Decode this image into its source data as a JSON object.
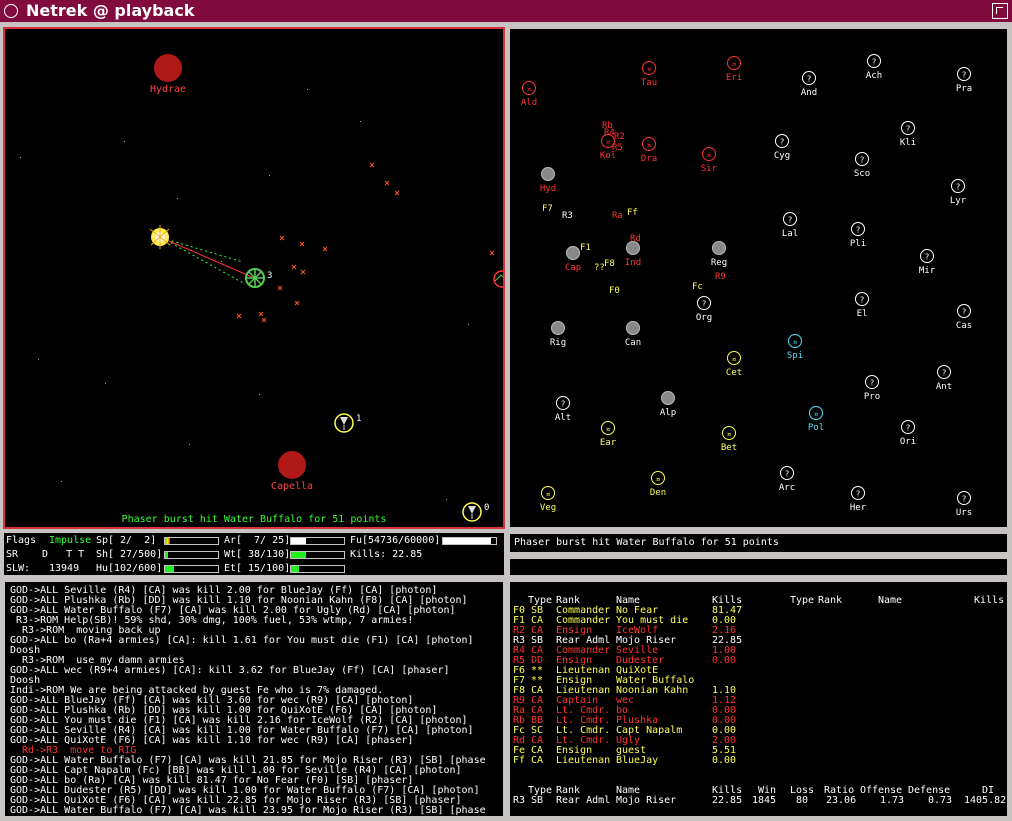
{
  "window": {
    "title": "Netrek  @  playback"
  },
  "tactical": {
    "message": "Phaser burst hit Water Buffalo for 51 points",
    "planets": [
      {
        "name": "Hydrae"
      },
      {
        "name": "Capella"
      }
    ],
    "ships": [
      {
        "id": "3"
      },
      {
        "id": "1"
      },
      {
        "id": "0"
      }
    ]
  },
  "galactic": {
    "planets": [
      {
        "name": "Ald",
        "owner": "red"
      },
      {
        "name": "Tau",
        "owner": "red"
      },
      {
        "name": "Eri",
        "owner": "red"
      },
      {
        "name": "And",
        "owner": "neutral"
      },
      {
        "name": "Ach",
        "owner": "neutral"
      },
      {
        "name": "Pra",
        "owner": "neutral"
      },
      {
        "name": "Kli",
        "owner": "neutral"
      },
      {
        "name": "Kol",
        "owner": "red"
      },
      {
        "name": "Dra",
        "owner": "red"
      },
      {
        "name": "Sir",
        "owner": "red"
      },
      {
        "name": "Cyg",
        "owner": "neutral"
      },
      {
        "name": "Sco",
        "owner": "neutral"
      },
      {
        "name": "Lyr",
        "owner": "neutral"
      },
      {
        "name": "Hyd",
        "owner": "red"
      },
      {
        "name": "Lal",
        "owner": "neutral"
      },
      {
        "name": "Pli",
        "owner": "neutral"
      },
      {
        "name": "Mir",
        "owner": "neutral"
      },
      {
        "name": "Cap",
        "owner": "red"
      },
      {
        "name": "Ind",
        "owner": "red"
      },
      {
        "name": "Reg",
        "owner": "neutral"
      },
      {
        "name": "Org",
        "owner": "neutral"
      },
      {
        "name": "El",
        "owner": "neutral"
      },
      {
        "name": "Cas",
        "owner": "neutral"
      },
      {
        "name": "Rig",
        "owner": "neutral"
      },
      {
        "name": "Can",
        "owner": "neutral"
      },
      {
        "name": "Spi",
        "owner": "cyan"
      },
      {
        "name": "Cet",
        "owner": "yellow"
      },
      {
        "name": "Ant",
        "owner": "neutral"
      },
      {
        "name": "Pro",
        "owner": "neutral"
      },
      {
        "name": "Alt",
        "owner": "neutral"
      },
      {
        "name": "Alp",
        "owner": "neutral"
      },
      {
        "name": "Pol",
        "owner": "cyan"
      },
      {
        "name": "Ear",
        "owner": "yellow"
      },
      {
        "name": "Bet",
        "owner": "yellow"
      },
      {
        "name": "Ori",
        "owner": "neutral"
      },
      {
        "name": "Arc",
        "owner": "neutral"
      },
      {
        "name": "Den",
        "owner": "yellow"
      },
      {
        "name": "Veg",
        "owner": "yellow"
      },
      {
        "name": "Her",
        "owner": "neutral"
      },
      {
        "name": "Urs",
        "owner": "neutral"
      }
    ],
    "ship_labels": [
      "Rb",
      "R4",
      "R2",
      "R5",
      "F7",
      "R3",
      "Ra",
      "Ff",
      "Rd",
      "F1",
      "F8",
      "??",
      "F0",
      "Fc",
      "R9"
    ]
  },
  "stats": {
    "flags_label": "Flags",
    "flags_value": "Impulse",
    "sr_label": "SR",
    "sr_value": "D   T T",
    "slw_label": "SLW:",
    "slw_value": "13949",
    "speed": {
      "label": "Sp[",
      "value": " 2/  2]",
      "fraction": 0.1
    },
    "shield": {
      "label": "Sh[",
      "value": " 27/500]",
      "fraction": 0.054
    },
    "hull": {
      "label": "Hu[",
      "value": "102/600]",
      "fraction": 0.17
    },
    "armies": {
      "label": "Ar[",
      "value": "  7/ 25]",
      "fraction": 0.28
    },
    "weapon_temp": {
      "label": "Wt[",
      "value": " 38/130]",
      "fraction": 0.29
    },
    "engine_temp": {
      "label": "Et[",
      "value": " 15/100]",
      "fraction": 0.15
    },
    "fuel": {
      "label": "Fu[",
      "value": "54736/60000]",
      "fraction": 0.91
    },
    "kills": "Kills: 22.85"
  },
  "warning": "Phaser burst hit Water Buffalo for 51 points",
  "review": [
    {
      "text": "GOD->ALL Seville (R4) [CA] was kill 2.00 for BlueJay (Ff) [CA] [photon]",
      "color": "#ffffff"
    },
    {
      "text": "GOD->ALL Plushka (Rb) [DD] was kill 1.10 for Noonian Kahn (F8) [CA] [photon]",
      "color": "#ffffff"
    },
    {
      "text": "GOD->ALL Water Buffalo (F7) [CA] was kill 2.00 for Ugly (Rd) [CA] [photon]",
      "color": "#ffffff"
    },
    {
      "text": " R3->ROM Help(SB)! 59% shd, 30% dmg, 100% fuel, 53% wtmp, 7 armies!",
      "color": "#ffffff"
    },
    {
      "text": "  R3->ROM  moving back up",
      "color": "#ffffff"
    },
    {
      "text": "GOD->ALL bo (Ra+4 armies) [CA]: kill 1.61 for You must die (F1) [CA] [photon]",
      "color": "#ffffff"
    },
    {
      "text": "Doosh",
      "color": "#ffffff"
    },
    {
      "text": "  R3->ROM  use my damn armies",
      "color": "#ffffff"
    },
    {
      "text": "GOD->ALL wec (R9+4 armies) [CA]: kill 3.62 for BlueJay (Ff) [CA] [phaser]",
      "color": "#ffffff"
    },
    {
      "text": "Doosh",
      "color": "#ffffff"
    },
    {
      "text": "Indi->ROM We are being attacked by guest Fe who is 7% damaged.",
      "color": "#ffffff"
    },
    {
      "text": "GOD->ALL BlueJay (Ff) [CA] was kill 3.60 for wec (R9) [CA] [photon]",
      "color": "#ffffff"
    },
    {
      "text": "GOD->ALL Plushka (Rb) [DD] was kill 1.00 for QuiXotE (F6) [CA] [photon]",
      "color": "#ffffff"
    },
    {
      "text": "GOD->ALL You must die (F1) [CA] was kill 2.16 for IceWolf (R2) [CA] [photon]",
      "color": "#ffffff"
    },
    {
      "text": "GOD->ALL Seville (R4) [CA] was kill 1.00 for Water Buffalo (F7) [CA] [photon]",
      "color": "#ffffff"
    },
    {
      "text": "GOD->ALL QuiXotE (F6) [CA] was kill 1.10 for wec (R9) [CA] [phaser]",
      "color": "#ffffff"
    },
    {
      "text": "  Rd->R3  move to RIG",
      "color": "#ff3333"
    },
    {
      "text": "GOD->ALL Water Buffalo (F7) [CA] was kill 21.85 for Mojo Riser (R3) [SB] [phase",
      "color": "#ffffff"
    },
    {
      "text": "GOD->ALL Capt Napalm (Fc) [BB] was kill 1.00 for Seville (R4) [CA] [photon]",
      "color": "#ffffff"
    },
    {
      "text": "GOD->ALL bo (Ra) [CA] was kill 81.47 for No Fear (F0) [SB] [phaser]",
      "color": "#ffffff"
    },
    {
      "text": "GOD->ALL Dudester (R5) [DD] was kill 1.00 for Water Buffalo (F7) [CA] [photon]",
      "color": "#ffffff"
    },
    {
      "text": "GOD->ALL QuiXotE (F6) [CA] was kill 22.85 for Mojo Riser (R3) [SB] [phaser]",
      "color": "#ffffff"
    },
    {
      "text": "GOD->ALL Water Buffalo (F7) [CA] was kill 23.95 for Mojo Riser (R3) [SB] [phase",
      "color": "#ffffff"
    }
  ],
  "players": {
    "headers": {
      "type": "Type",
      "rank": "Rank",
      "name": "Name",
      "kills": "Kills"
    },
    "rows": [
      {
        "id": "F0",
        "type": "SB",
        "rank": "Commander",
        "name": "No Fear",
        "kills": "81.47",
        "color": "#ffff55"
      },
      {
        "id": "F1",
        "type": "CA",
        "rank": "Commander",
        "name": "You must die",
        "kills": "0.00",
        "color": "#ffff55"
      },
      {
        "id": "R2",
        "type": "CA",
        "rank": "Ensign",
        "name": "IceWolf",
        "kills": "2.16",
        "color": "#ff3333"
      },
      {
        "id": "R3",
        "type": "SB",
        "rank": "Rear Adml",
        "name": "Mojo Riser",
        "kills": "22.85",
        "color": "#ffffff"
      },
      {
        "id": "R4",
        "type": "CA",
        "rank": "Commander",
        "name": "Seville",
        "kills": "1.00",
        "color": "#ff3333"
      },
      {
        "id": "R5",
        "type": "DD",
        "rank": "Ensign",
        "name": "Dudester",
        "kills": "0.00",
        "color": "#ff3333"
      },
      {
        "id": "F6",
        "type": "**",
        "rank": "Lieutenan",
        "name": "QuiXotE",
        "kills": "",
        "color": "#ffff55"
      },
      {
        "id": "F7",
        "type": "**",
        "rank": "Ensign",
        "name": "Water Buffalo",
        "kills": "",
        "color": "#ffff55"
      },
      {
        "id": "F8",
        "type": "CA",
        "rank": "Lieutenan",
        "name": "Noonian Kahn",
        "kills": "1.10",
        "color": "#ffff55"
      },
      {
        "id": "R9",
        "type": "CA",
        "rank": "Captain",
        "name": "wec",
        "kills": "1.12",
        "color": "#ff3333"
      },
      {
        "id": "Ra",
        "type": "CA",
        "rank": "Lt. Cmdr.",
        "name": "bo",
        "kills": "0.00",
        "color": "#ff3333"
      },
      {
        "id": "Rb",
        "type": "BB",
        "rank": "Lt. Cmdr.",
        "name": "Plushka",
        "kills": "0.00",
        "color": "#ff3333"
      },
      {
        "id": "Fc",
        "type": "SC",
        "rank": "Lt. Cmdr.",
        "name": "Capt Napalm",
        "kills": "0.00",
        "color": "#ffff55"
      },
      {
        "id": "Rd",
        "type": "CA",
        "rank": "Lt. Cmdr.",
        "name": "Ugly",
        "kills": "2.00",
        "color": "#ff3333"
      },
      {
        "id": "Fe",
        "type": "CA",
        "rank": "Ensign",
        "name": "guest",
        "kills": "5.51",
        "color": "#ffff55"
      },
      {
        "id": "Ff",
        "type": "CA",
        "rank": "Lieutenan",
        "name": "BlueJay",
        "kills": "0.00",
        "color": "#ffff55"
      }
    ],
    "summary_headers": {
      "type": "Type",
      "rank": "Rank",
      "name": "Name",
      "kills": "Kills",
      "win": "Win",
      "loss": "Loss",
      "ratio": "Ratio",
      "offense": "Offense",
      "defense": "Defense",
      "di": "DI"
    },
    "summary": {
      "id": "R3",
      "type": "SB",
      "rank": "Rear Adml",
      "name": "Mojo Riser",
      "kills": "22.85",
      "win": "1845",
      "loss": "80",
      "ratio": "23.06",
      "offense": "1.73",
      "defense": "0.73",
      "di": "1405.82"
    }
  },
  "colors": {
    "title_bar": "#800b3c",
    "federation": "#ffff55",
    "romulan": "#ff3333",
    "neutral": "#ffffff",
    "cyan": "#55ddff",
    "frame": "#c7c3c3"
  }
}
